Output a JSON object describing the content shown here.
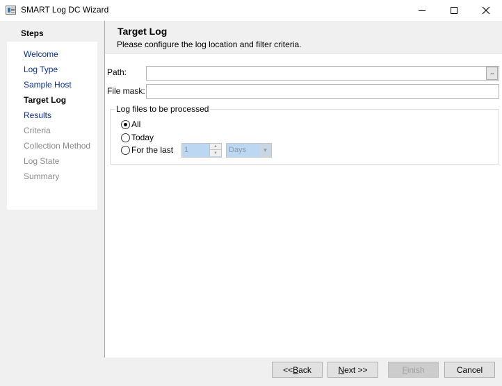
{
  "window": {
    "title": "SMART Log DC Wizard"
  },
  "steps": {
    "heading": "Steps",
    "items": [
      {
        "label": "Welcome",
        "state": "link"
      },
      {
        "label": "Log Type",
        "state": "link"
      },
      {
        "label": "Sample Host",
        "state": "link"
      },
      {
        "label": "Target Log",
        "state": "current"
      },
      {
        "label": "Results",
        "state": "link"
      },
      {
        "label": "Criteria",
        "state": "disabled"
      },
      {
        "label": "Collection Method",
        "state": "disabled"
      },
      {
        "label": "Log State",
        "state": "disabled"
      },
      {
        "label": "Summary",
        "state": "disabled"
      }
    ]
  },
  "header": {
    "title": "Target Log",
    "subtitle": "Please configure the log location and filter criteria."
  },
  "form": {
    "path_label": "Path:",
    "path_value": "",
    "browse_label": "...",
    "filemask_label": "File mask:",
    "filemask_value": "",
    "group_label": "Log files to be processed",
    "radio_all": "All",
    "radio_today": "Today",
    "radio_last": "For the last",
    "selected": "All",
    "last_count": "1",
    "last_unit": "Days"
  },
  "footer": {
    "back_pre": "<< ",
    "back_key": "B",
    "back_post": "ack",
    "next_key": "N",
    "next_post": "ext >>",
    "finish_key": "F",
    "finish_post": "inish",
    "cancel": "Cancel"
  }
}
